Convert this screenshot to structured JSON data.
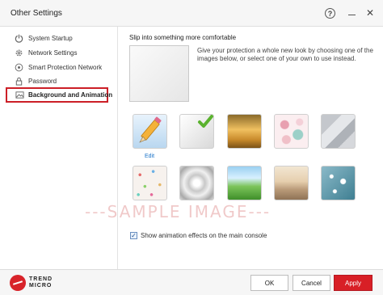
{
  "window": {
    "title": "Other Settings"
  },
  "titlebar": {
    "help_icon": "?",
    "close_icon": "✕"
  },
  "sidebar": {
    "items": [
      {
        "label": "System Startup",
        "icon": "power-icon"
      },
      {
        "label": "Network Settings",
        "icon": "gear-icon"
      },
      {
        "label": "Smart Protection Network",
        "icon": "network-icon"
      },
      {
        "label": "Password",
        "icon": "lock-icon"
      },
      {
        "label": "Background and Animation",
        "icon": "image-icon",
        "selected": true
      }
    ]
  },
  "main": {
    "heading": "Slip into something more comfortable",
    "description": "Give your protection a whole new look by choosing one of the images below, or select one of your own to use instead.",
    "edit_label": "Edit",
    "animation_checkbox": {
      "label": "Show animation effects on the main console",
      "checked": true,
      "mark": "✓"
    },
    "thumbnails": [
      {
        "name": "edit-custom",
        "selected": false
      },
      {
        "name": "plain-white",
        "selected": true
      },
      {
        "name": "wheat-field",
        "selected": false
      },
      {
        "name": "pink-circles",
        "selected": false
      },
      {
        "name": "gray-polygons",
        "selected": false
      },
      {
        "name": "confetti-dots",
        "selected": false
      },
      {
        "name": "silver-radial",
        "selected": false
      },
      {
        "name": "green-grass",
        "selected": false
      },
      {
        "name": "sunset-beach",
        "selected": false
      },
      {
        "name": "blue-snowflakes",
        "selected": false
      }
    ]
  },
  "watermark": "---SAMPLE IMAGE---",
  "footer": {
    "logo_line1": "TREND",
    "logo_line2": "MICRO",
    "ok_label": "OK",
    "cancel_label": "Cancel",
    "apply_label": "Apply"
  },
  "colors": {
    "accent": "#d81f26",
    "link": "#1a73c8",
    "check": "#5ab22e"
  }
}
